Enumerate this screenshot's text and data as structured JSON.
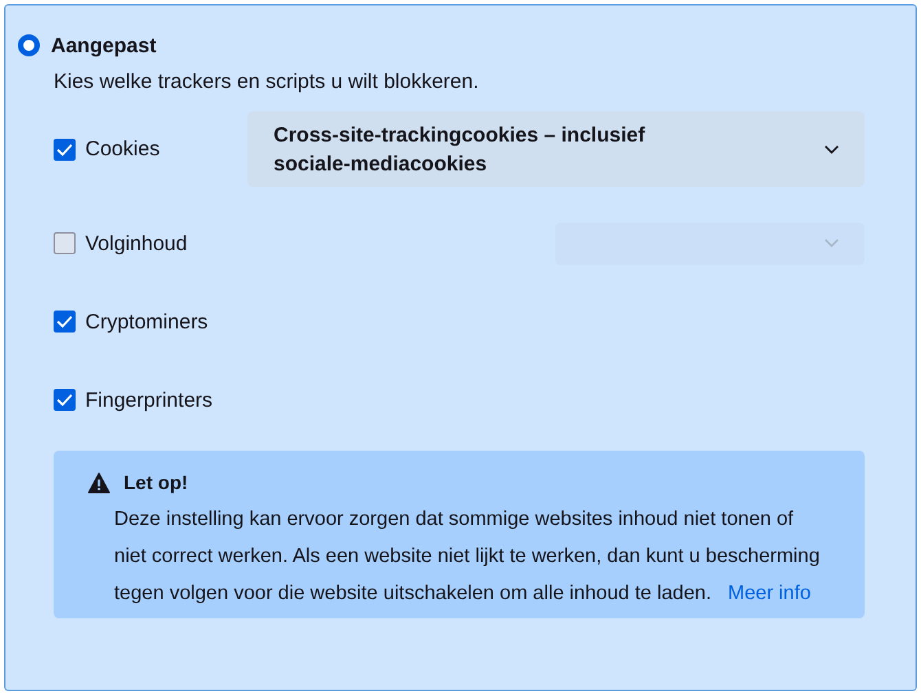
{
  "option": {
    "label": "Aangepast",
    "selected": true
  },
  "description": "Kies welke trackers en scripts u wilt blokkeren.",
  "trackers": [
    {
      "label": "Cookies",
      "checked": true,
      "dropdown": {
        "value": "Cross-site-trackingcookies – inclusief sociale-mediacookies",
        "disabled": false
      }
    },
    {
      "label": "Volginhoud",
      "checked": false,
      "dropdown": {
        "disabled": true
      }
    },
    {
      "label": "Cryptominers",
      "checked": true
    },
    {
      "label": "Fingerprinters",
      "checked": true
    }
  ],
  "warning": {
    "title": "Let op!",
    "text": "Deze instelling kan ervoor zorgen dat sommige websites inhoud niet tonen of niet correct werken. Als een website niet lijkt te werken, dan kunt u bescherming tegen volgen voor die website uitschakelen om alle inhoud te laden.",
    "link": "Meer info"
  }
}
